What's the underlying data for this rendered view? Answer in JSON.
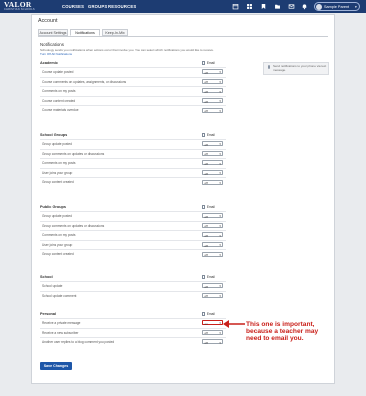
{
  "topbar": {
    "logo": "VALOR",
    "logo_sub": "CHRISTIAN SCHOOLS",
    "nav": [
      "COURSES",
      "GROUPS",
      "RESOURCES"
    ],
    "icons": [
      "calendar-icon",
      "grid-icon",
      "bookmark-icon",
      "folder-icon",
      "envelope-icon",
      "bell-icon"
    ],
    "user_name": "Sample Parent"
  },
  "page": {
    "title": "Account",
    "tabs": [
      "Account Settings",
      "Notifications",
      "Keep-In-Mix"
    ],
    "active_tab": 1
  },
  "notifications": {
    "title": "Notifications",
    "description": "Schoology sends you notifications when actions occur that involve you. You can select which notifications you would like to receive.",
    "turn_off_link": "Turn Off All Notifications",
    "info_text": "Send notifications to your phone via text message.",
    "email_label": "Email",
    "groups": [
      {
        "name": "Academic",
        "rows": [
          {
            "label": "Course update posted",
            "value": "off"
          },
          {
            "label": "Course comments on updates, assignments, or discussions",
            "value": "off"
          },
          {
            "label": "Comments on my posts",
            "value": "off"
          },
          {
            "label": "Course content created",
            "value": "off"
          },
          {
            "label": "Course materials overdue",
            "value": "off"
          }
        ]
      },
      {
        "name": "School Groups",
        "rows": [
          {
            "label": "Group update posted",
            "value": "off"
          },
          {
            "label": "Group comments on updates or discussions",
            "value": "off"
          },
          {
            "label": "Comments on my posts",
            "value": "off"
          },
          {
            "label": "User joins your group",
            "value": "off"
          },
          {
            "label": "Group content created",
            "value": "off"
          }
        ]
      },
      {
        "name": "Public Groups",
        "rows": [
          {
            "label": "Group update posted",
            "value": "off"
          },
          {
            "label": "Group comments on updates or discussions",
            "value": "off"
          },
          {
            "label": "Comments on my posts",
            "value": "off"
          },
          {
            "label": "User joins your group",
            "value": "off"
          },
          {
            "label": "Group content created",
            "value": "off"
          }
        ]
      },
      {
        "name": "School",
        "rows": [
          {
            "label": "School update",
            "value": "off"
          },
          {
            "label": "School update comment",
            "value": "off"
          }
        ]
      },
      {
        "name": "Personal",
        "rows": [
          {
            "label": "Receive a private message",
            "value": "on"
          },
          {
            "label": "Receive a new subscriber",
            "value": "off"
          },
          {
            "label": "Another user replies to a blog comment you posted",
            "value": "off"
          }
        ]
      }
    ]
  },
  "annotation": {
    "lines": [
      "This one is important,",
      "because a teacher may",
      "need to email you."
    ],
    "color": "#c9201a"
  },
  "save_label": "Save Changes"
}
